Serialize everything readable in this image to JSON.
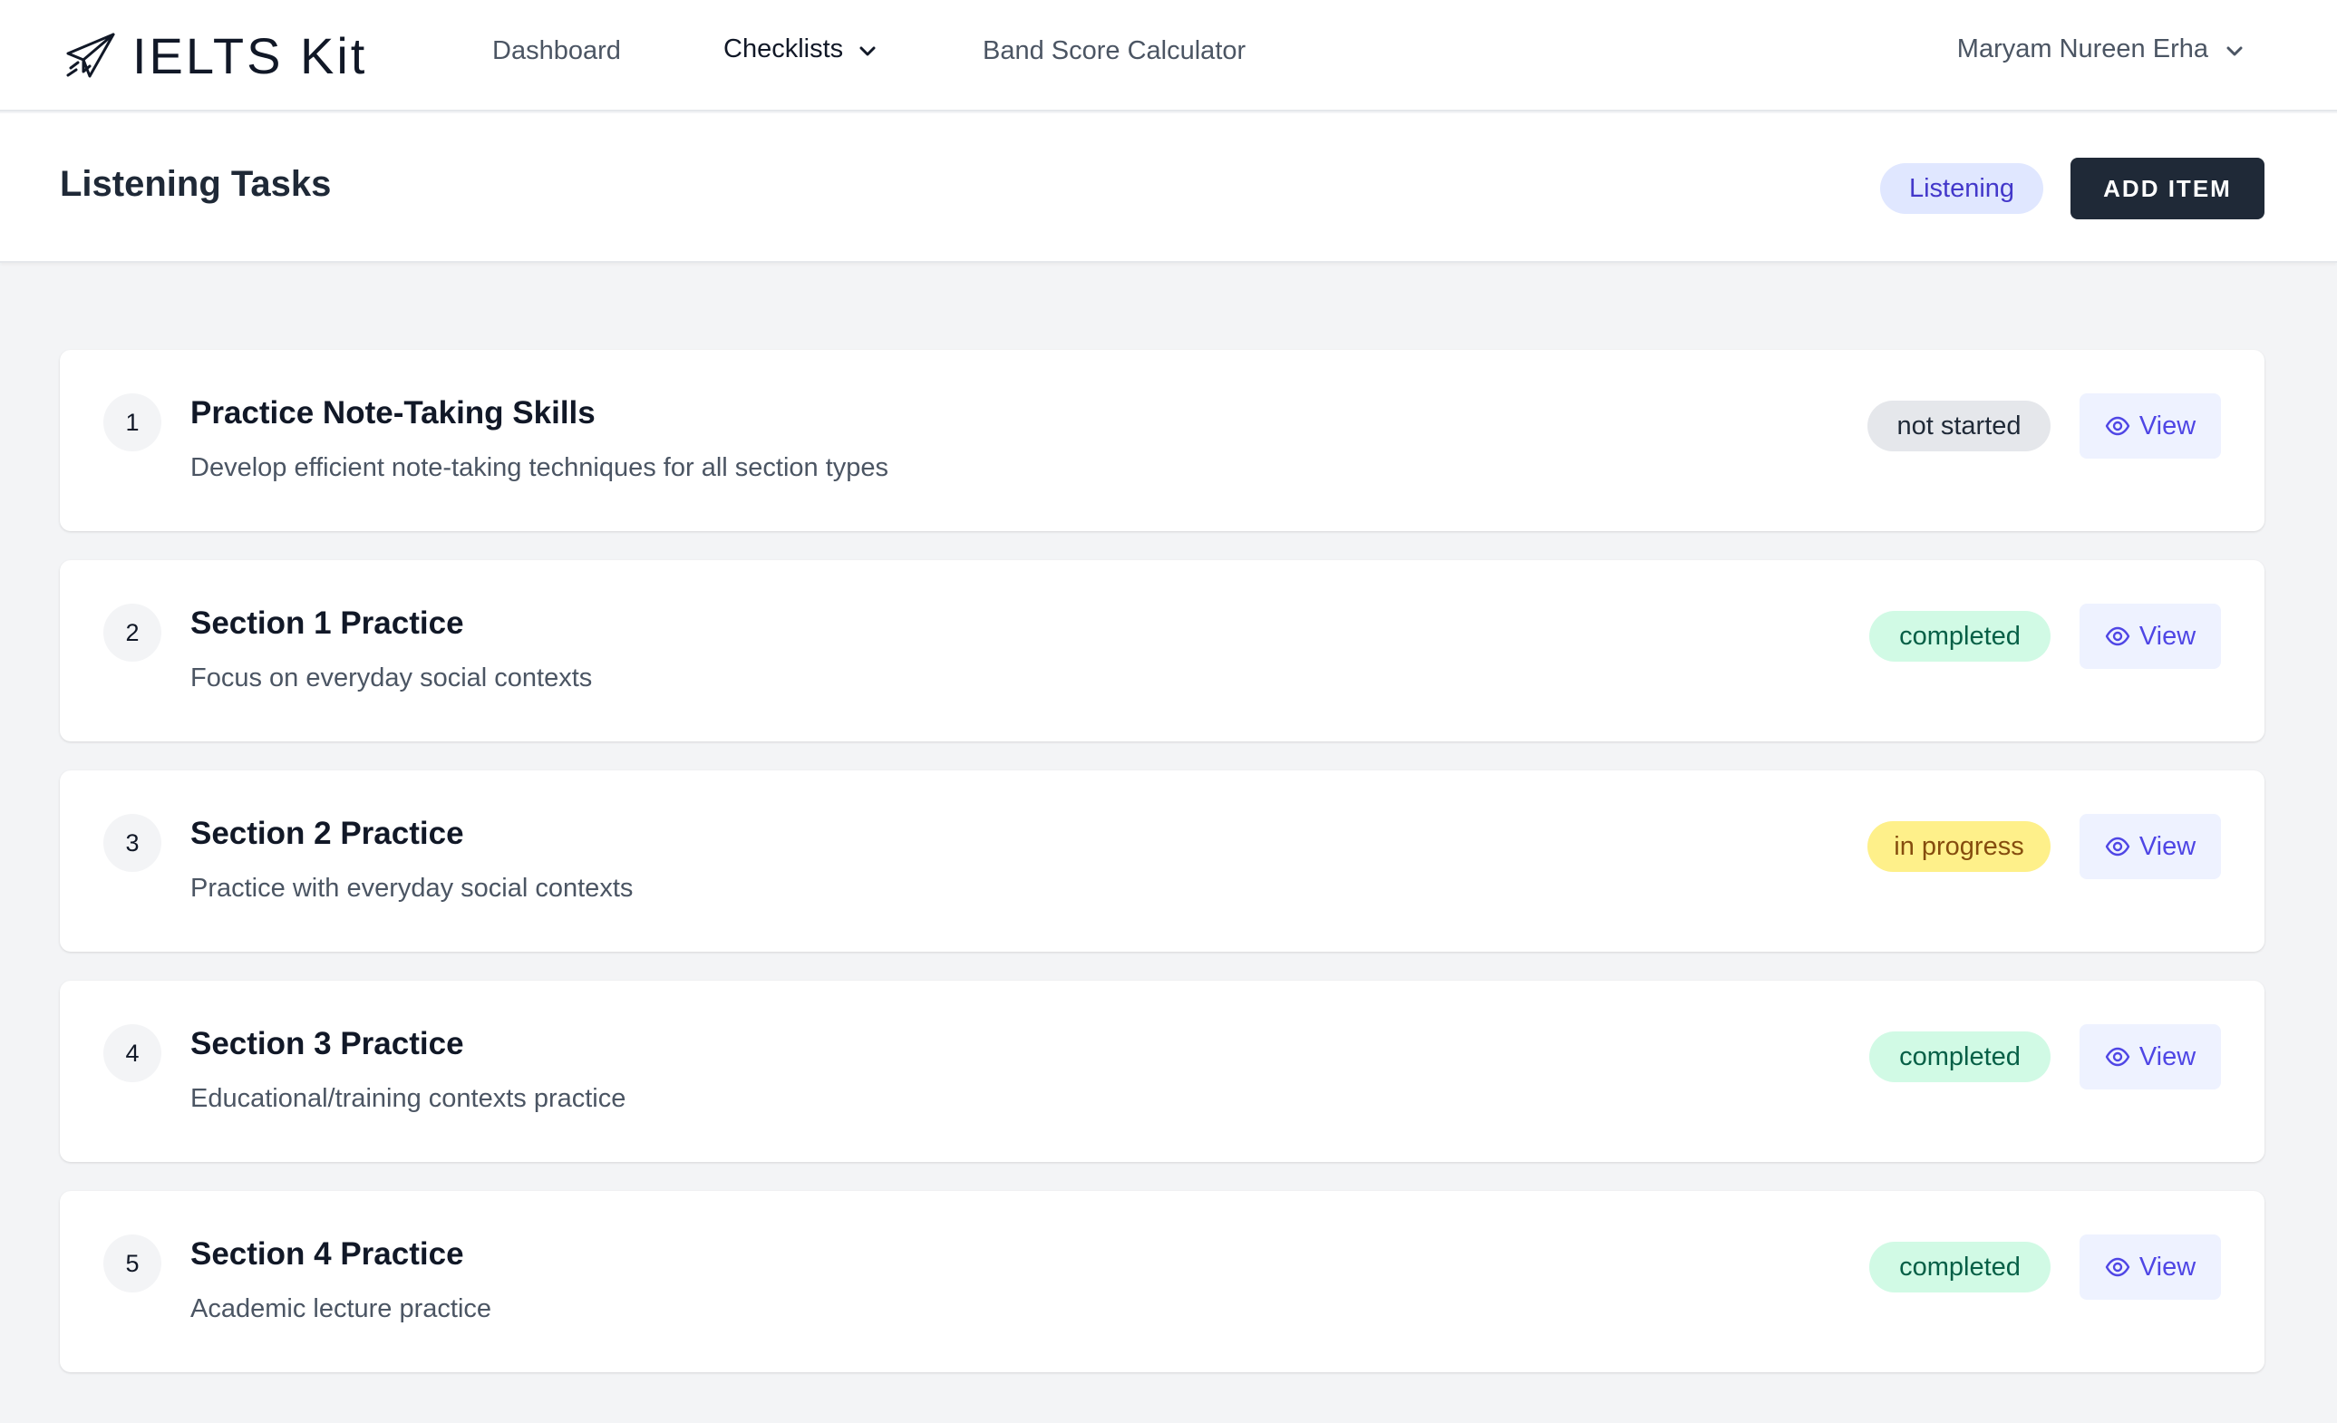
{
  "nav": {
    "brand": "IELTS Kit",
    "links": {
      "dashboard": "Dashboard",
      "checklists": "Checklists",
      "calculator": "Band Score Calculator"
    },
    "user_name": "Maryam Nureen Erha"
  },
  "header": {
    "title": "Listening Tasks",
    "category_badge": "Listening",
    "add_button_label": "ADD ITEM"
  },
  "tasks": [
    {
      "number": "1",
      "title": "Practice Note-Taking Skills",
      "description": "Develop efficient note-taking techniques for all section types",
      "status": "not started",
      "action_label": "View"
    },
    {
      "number": "2",
      "title": "Section 1 Practice",
      "description": "Focus on everyday social contexts",
      "status": "completed",
      "action_label": "View"
    },
    {
      "number": "3",
      "title": "Section 2 Practice",
      "description": "Practice with everyday social contexts",
      "status": "in progress",
      "action_label": "View"
    },
    {
      "number": "4",
      "title": "Section 3 Practice",
      "description": "Educational/training contexts practice",
      "status": "completed",
      "action_label": "View"
    },
    {
      "number": "5",
      "title": "Section 4 Practice",
      "description": "Academic lecture practice",
      "status": "completed",
      "action_label": "View"
    }
  ],
  "colors": {
    "primary_dark": "#1f2937",
    "accent_indigo": "#4f46e5",
    "status_not_started": "#e5e7eb",
    "status_completed": "#d1fae5",
    "status_in_progress": "#fef08a",
    "page_background": "#f3f4f6"
  },
  "icons": {
    "brand": "paper-plane-icon",
    "dropdown": "chevron-down-icon",
    "view": "eye-icon"
  }
}
